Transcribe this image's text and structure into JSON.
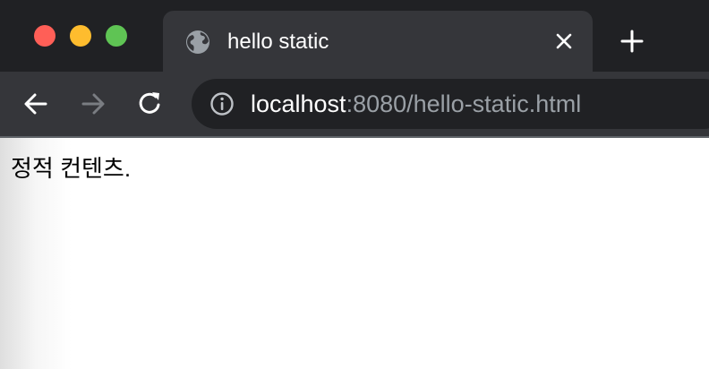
{
  "window": {
    "controls": [
      "close-button",
      "minimize-button",
      "maximize-button"
    ]
  },
  "tab": {
    "title": "hello static",
    "icon": "globe-icon",
    "close_icon": "close-icon"
  },
  "new_tab_icon": "plus-icon",
  "toolbar": {
    "back_icon": "back-arrow-icon",
    "forward_icon": "forward-arrow-icon",
    "reload_icon": "reload-icon"
  },
  "address_bar": {
    "info_icon": "info-icon",
    "host": "localhost",
    "rest": ":8080/hello-static.html"
  },
  "page": {
    "text": "정적 컨텐츠."
  },
  "colors": {
    "titlebar": "#202124",
    "tab": "#35363a",
    "omnibox": "#202124",
    "url_dim": "#9aa0a6",
    "close": "#ff5f57",
    "minimize": "#febc2e",
    "maximize": "#5fc454"
  }
}
